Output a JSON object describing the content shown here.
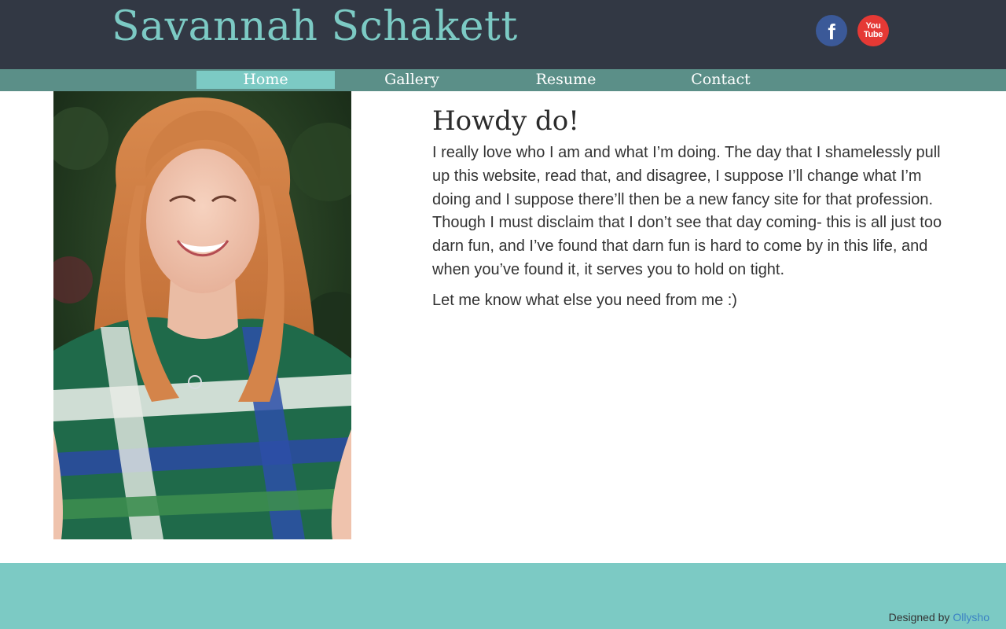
{
  "header": {
    "site_title": "Savannah Schakett",
    "social": [
      {
        "name": "facebook",
        "glyph": "f"
      },
      {
        "name": "youtube",
        "glyph_line1": "You",
        "glyph_line2": "Tube"
      }
    ]
  },
  "nav": {
    "items": [
      {
        "label": "Home",
        "active": true
      },
      {
        "label": "Gallery",
        "active": false
      },
      {
        "label": "Resume",
        "active": false
      },
      {
        "label": "Contact",
        "active": false
      }
    ]
  },
  "main": {
    "heading": "Howdy do!",
    "paragraphs": [
      "I really love who I am and what I’m doing. The day that I shamelessly pull up this website, read that, and disagree, I suppose I’ll change what I’m doing and I suppose there’ll then be a new fancy site for that profession. Though I must disclaim that I don’t see that day coming- this is all just too darn fun, and I’ve found that darn fun is hard to come by in this life, and when you’ve found it, it serves you to hold on tight.",
      "Let me know what else you need from me :)"
    ]
  },
  "footer": {
    "credit_prefix": "Designed by ",
    "credit_link": "Ollysho"
  },
  "colors": {
    "header_bg": "#323844",
    "nav_bg": "#5b8f88",
    "accent": "#7ccac4",
    "facebook": "#3b5998",
    "youtube": "#e53935",
    "link": "#3b82c4"
  }
}
